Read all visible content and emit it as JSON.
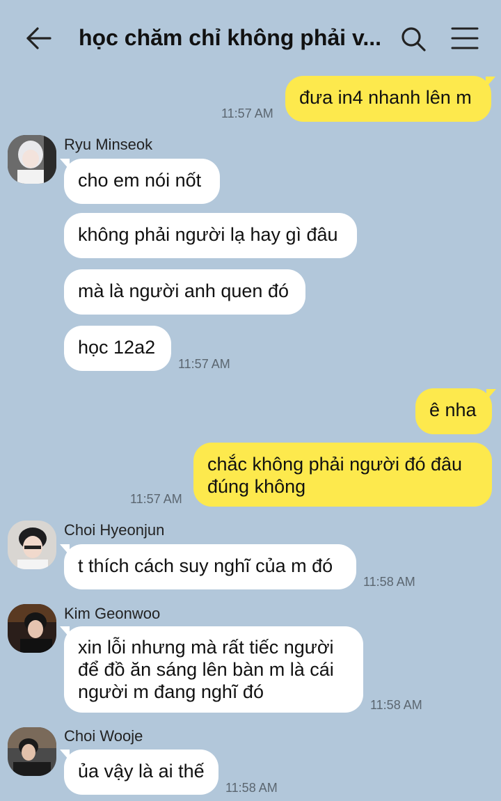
{
  "header": {
    "title": "học chăm chỉ không phải v...",
    "back_icon": "arrow-left-icon",
    "search_icon": "search-icon",
    "menu_icon": "hamburger-menu-icon"
  },
  "colors": {
    "background": "#b2c7da",
    "my_bubble": "#fde94d",
    "their_bubble": "#ffffff"
  },
  "messages": [
    {
      "sender": "me",
      "text": "đưa in4 nhanh lên m",
      "time": "11:57 AM"
    },
    {
      "sender": "Ryu Minseok",
      "texts": [
        "cho em nói nốt",
        "không phải người lạ hay gì đâu",
        "mà là người anh quen đó",
        "học 12a2"
      ],
      "time": "11:57 AM"
    },
    {
      "sender": "me",
      "texts": [
        "ê nha",
        "chắc không phải người đó đâu đúng không"
      ],
      "time": "11:57 AM"
    },
    {
      "sender": "Choi Hyeonjun",
      "text": "t thích cách suy nghĩ của m đó",
      "time": "11:58 AM"
    },
    {
      "sender": "Kim Geonwoo",
      "text": "xin lỗi nhưng mà rất tiếc người để đồ ăn sáng lên bàn m là cái người m đang nghĩ đó",
      "time": "11:58 AM"
    },
    {
      "sender": "Choi Wooje",
      "text": "ủa vậy là ai thế",
      "time": "11:58 AM"
    }
  ]
}
